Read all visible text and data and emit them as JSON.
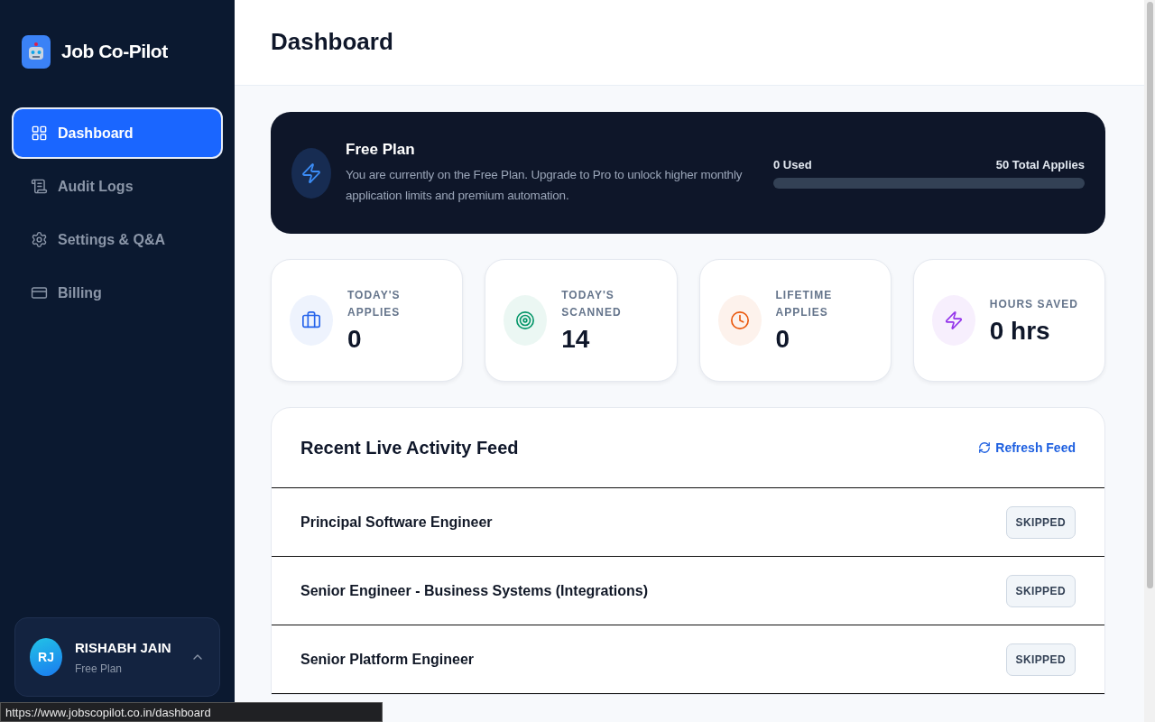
{
  "sidebar": {
    "brand": "Job Co-Pilot",
    "items": [
      {
        "label": "Dashboard",
        "kind": "grid",
        "selected": true
      },
      {
        "label": "Audit Logs",
        "kind": "scroll",
        "selected": false
      },
      {
        "label": "Settings & Q&A",
        "kind": "gear",
        "selected": false
      },
      {
        "label": "Billing",
        "kind": "card",
        "selected": false
      }
    ],
    "user": {
      "initials": "RJ",
      "name": "RISHABH JAIN",
      "plan": "Free Plan"
    }
  },
  "header": {
    "title": "Dashboard"
  },
  "plan": {
    "title": "Free Plan",
    "description": "You are currently on the Free Plan. Upgrade to Pro to unlock higher monthly application limits and premium automation.",
    "used": "0 Used",
    "total": "50 Total Applies",
    "level": 0
  },
  "stats": [
    {
      "label": "TODAY'S APPLIES",
      "value": "0",
      "kind": "briefcase",
      "color": "#2563eb"
    },
    {
      "label": "TODAY'S SCANNED",
      "value": "14",
      "kind": "target",
      "color": "#059669"
    },
    {
      "label": "LIFETIME APPLIES",
      "value": "0",
      "kind": "clock",
      "color": "#ea580c"
    },
    {
      "label": "HOURS SAVED",
      "value": "0 hrs",
      "kind": "zap",
      "color": "#9333ea"
    }
  ],
  "feed": {
    "title": "Recent Live Activity Feed",
    "refresh": "Refresh Feed",
    "rows": [
      {
        "title": "Principal Software Engineer",
        "status": "SKIPPED"
      },
      {
        "title": "Senior Engineer - Business Systems (Integrations)",
        "status": "SKIPPED"
      },
      {
        "title": "Senior Platform Engineer",
        "status": "SKIPPED"
      }
    ]
  },
  "status_url": "https://www.jobscopilot.co.in/dashboard"
}
